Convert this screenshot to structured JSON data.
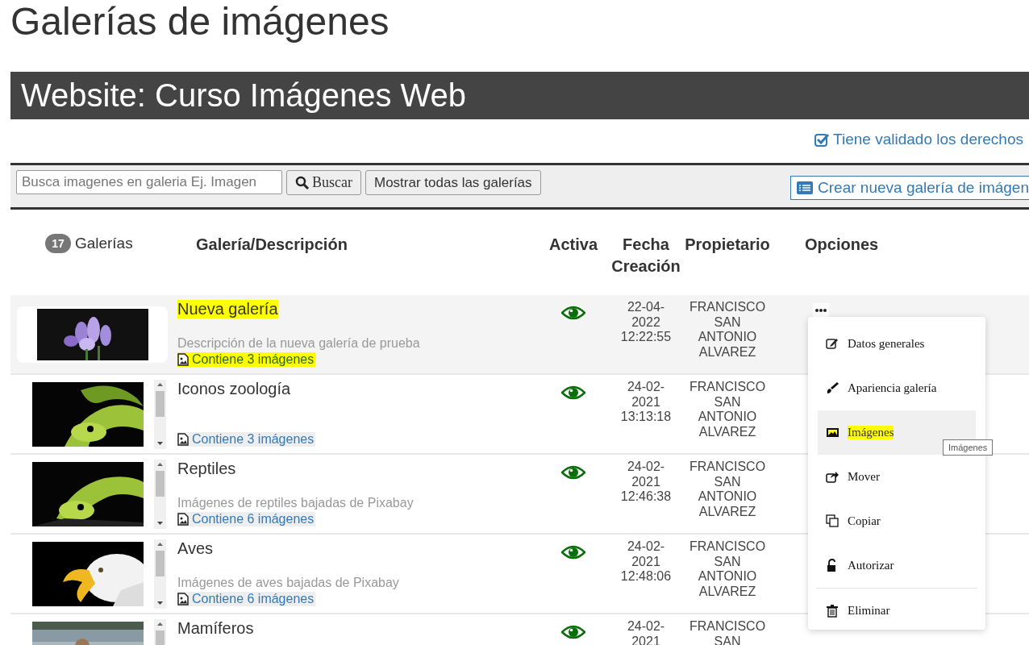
{
  "page_title": "Galerías de imágenes",
  "website_bar": {
    "title": "Website: Curso Imágenes Web"
  },
  "rights_link": {
    "label": "Tiene validado los derechos",
    "checked": true
  },
  "toolbar": {
    "search": {
      "placeholder": "Busca imagenes en galeria Ej. Imagen"
    },
    "search_button": "Buscar",
    "show_all_button": "Mostrar todas las galerías",
    "create_button": "Crear nueva galería de imágen"
  },
  "gallery_count": {
    "count": "17",
    "label": "Galerías"
  },
  "table": {
    "columns": [
      "Galería/Descripción",
      "Activa",
      "Fecha Creación",
      "Propietario",
      "Opciones"
    ],
    "rows": [
      {
        "title": "Nueva galería",
        "description": "Descripción de la nueva galería de prueba",
        "images_link": "Contiene 3 imágenes",
        "highlighted": true,
        "selected": true,
        "active": true,
        "date": [
          "22-04-",
          "2022",
          "12:22:55"
        ],
        "owner": [
          "FRANCISCO",
          "SAN",
          "ANTONIO",
          "ALVAREZ"
        ]
      },
      {
        "title": "Iconos zoología",
        "images_link": "Contiene 3 imágenes",
        "highlighted": false,
        "selected": false,
        "active": true,
        "date": [
          "24-02-",
          "2021",
          "13:13:18"
        ],
        "owner": [
          "FRANCISCO",
          "SAN",
          "ANTONIO",
          "ALVAREZ"
        ]
      },
      {
        "title": "Reptiles",
        "description": "Imágenes de reptiles bajadas de Pixabay",
        "images_link": "Contiene 6 imágenes",
        "highlighted": false,
        "selected": false,
        "active": true,
        "date": [
          "24-02-",
          "2021",
          "12:46:38"
        ],
        "owner": [
          "FRANCISCO",
          "SAN",
          "ANTONIO",
          "ALVAREZ"
        ]
      },
      {
        "title": "Aves",
        "description": "Imágenes de aves bajadas de Pixabay",
        "images_link": "Contiene 6 imágenes",
        "highlighted": false,
        "selected": false,
        "active": true,
        "date": [
          "24-02-",
          "2021",
          "12:48:06"
        ],
        "owner": [
          "FRANCISCO",
          "SAN",
          "ANTONIO",
          "ALVAREZ"
        ]
      },
      {
        "title": "Mamíferos",
        "selected": false,
        "highlighted": false,
        "active": true,
        "date": [
          "24-02-",
          "2021"
        ],
        "owner": [
          "FRANCISCO",
          "SAN"
        ]
      }
    ]
  },
  "options_menu": {
    "items": [
      {
        "label": "Datos generales",
        "selected": false
      },
      {
        "label": "Apariencia galería",
        "selected": false
      },
      {
        "label": "Imágenes",
        "selected": true
      },
      {
        "label": "Mover",
        "selected": false
      },
      {
        "label": "Copiar",
        "selected": false
      },
      {
        "label": "Autorizar",
        "selected": false
      },
      {
        "label": "Eliminar",
        "selected": false
      }
    ],
    "tooltip": "Imágenes"
  }
}
